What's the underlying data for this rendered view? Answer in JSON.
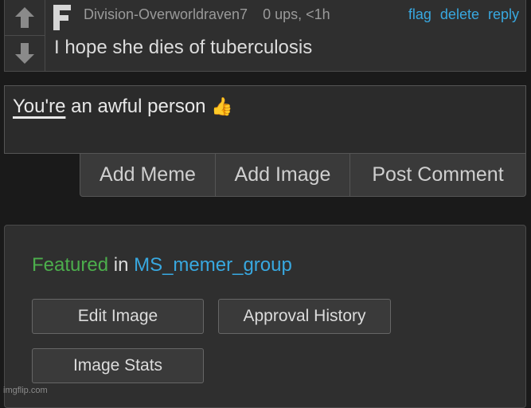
{
  "comment": {
    "username": "Division-Overworldraven7",
    "points": "0 ups, <1h",
    "actions": [
      "flag",
      "delete",
      "reply"
    ],
    "text": "I hope she dies of tuberculosis",
    "avatar_letter": "F",
    "upvote_icon": "arrow-up-icon",
    "downvote_icon": "arrow-down-icon"
  },
  "reply": {
    "misspelled_word": "You're",
    "rest_text": " an awful person ",
    "emoji": "👍"
  },
  "buttons": [
    "Add Meme",
    "Add Image",
    "Post Comment"
  ],
  "featured": {
    "label": "Featured",
    "in": " in ",
    "group": "MS_memer_group"
  },
  "panel_buttons": [
    "Edit Image",
    "Approval History",
    "Image Stats"
  ],
  "watermark": "imgflip.com",
  "colors": {
    "link": "#38a8e0",
    "featured": "#4cae4c",
    "background": "#1a1a1a",
    "panel": "#2f2f2f"
  }
}
